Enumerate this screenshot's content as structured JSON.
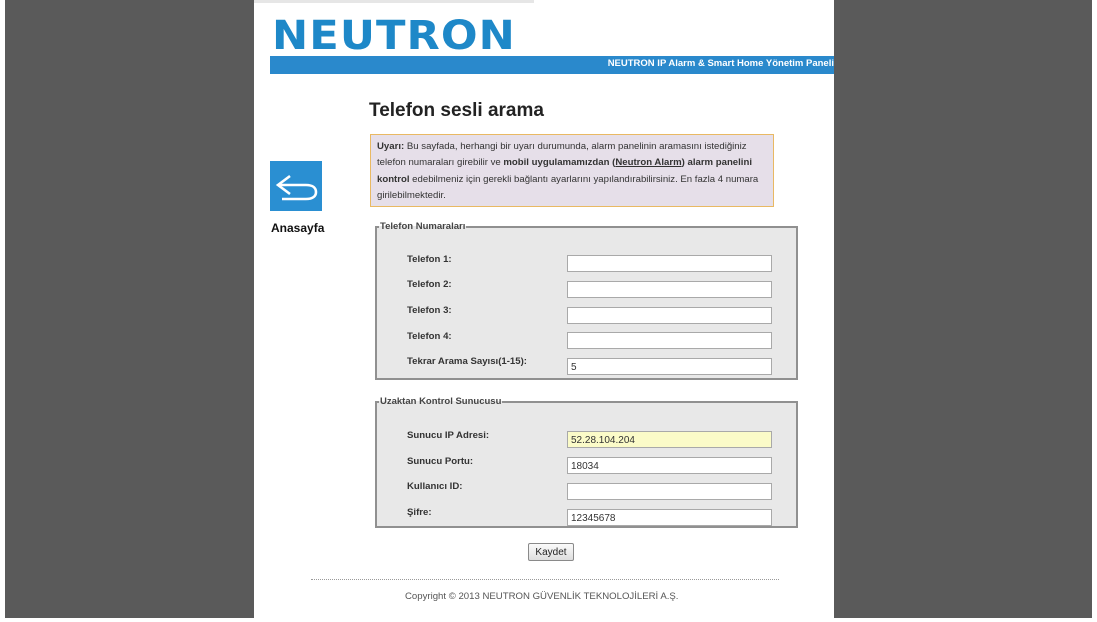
{
  "logo": {
    "text": "NEUTRON"
  },
  "banner": {
    "text": "NEUTRON IP Alarm & Smart Home Yönetim Paneli"
  },
  "nav": {
    "home_label": "Anasayfa",
    "home_icon": "return-arrow-icon"
  },
  "page": {
    "title": "Telefon sesli arama"
  },
  "warning": {
    "label": "Uyarı:",
    "text_1": " Bu sayfada, herhangi bir uyarı durumunda, alarm panelinin aramasını istediğiniz telefon numaraları girebilir ve ",
    "bold_1": "mobil uygulamamızdan (",
    "link": "Neutron Alarm",
    "bold_2": ") alarm panelini kontrol",
    "text_2": " edebilmeniz için gerekli bağlantı ayarlarını yapılandırabilirsiniz. En fazla 4 numara girilebilmektedir."
  },
  "phones": {
    "legend": "Telefon Numaraları",
    "rows": [
      {
        "label": "Telefon 1:",
        "value": ""
      },
      {
        "label": "Telefon 2:",
        "value": ""
      },
      {
        "label": "Telefon 3:",
        "value": ""
      },
      {
        "label": "Telefon 4:",
        "value": ""
      },
      {
        "label": "Tekrar Arama Sayısı(1-15):",
        "value": "5"
      }
    ]
  },
  "server": {
    "legend": "Uzaktan Kontrol Sunucusu",
    "rows": [
      {
        "label": "Sunucu IP Adresi:",
        "value": "52.28.104.204"
      },
      {
        "label": "Sunucu Portu:",
        "value": "18034"
      },
      {
        "label": "Kullanıcı ID:",
        "value": ""
      },
      {
        "label": "Şifre:",
        "value": "12345678"
      }
    ]
  },
  "actions": {
    "save_label": "Kaydet"
  },
  "footer": {
    "copyright": "Copyright © 2013 NEUTRON GÜVENLİK TEKNOLOJİLERİ A.Ş."
  },
  "colors": {
    "brand_blue": "#2a89cc",
    "side_gray": "#5a5a5a",
    "warning_bg": "#e6dfe9",
    "warning_border": "#e9b963",
    "highlight_input": "#fbfbc8"
  }
}
